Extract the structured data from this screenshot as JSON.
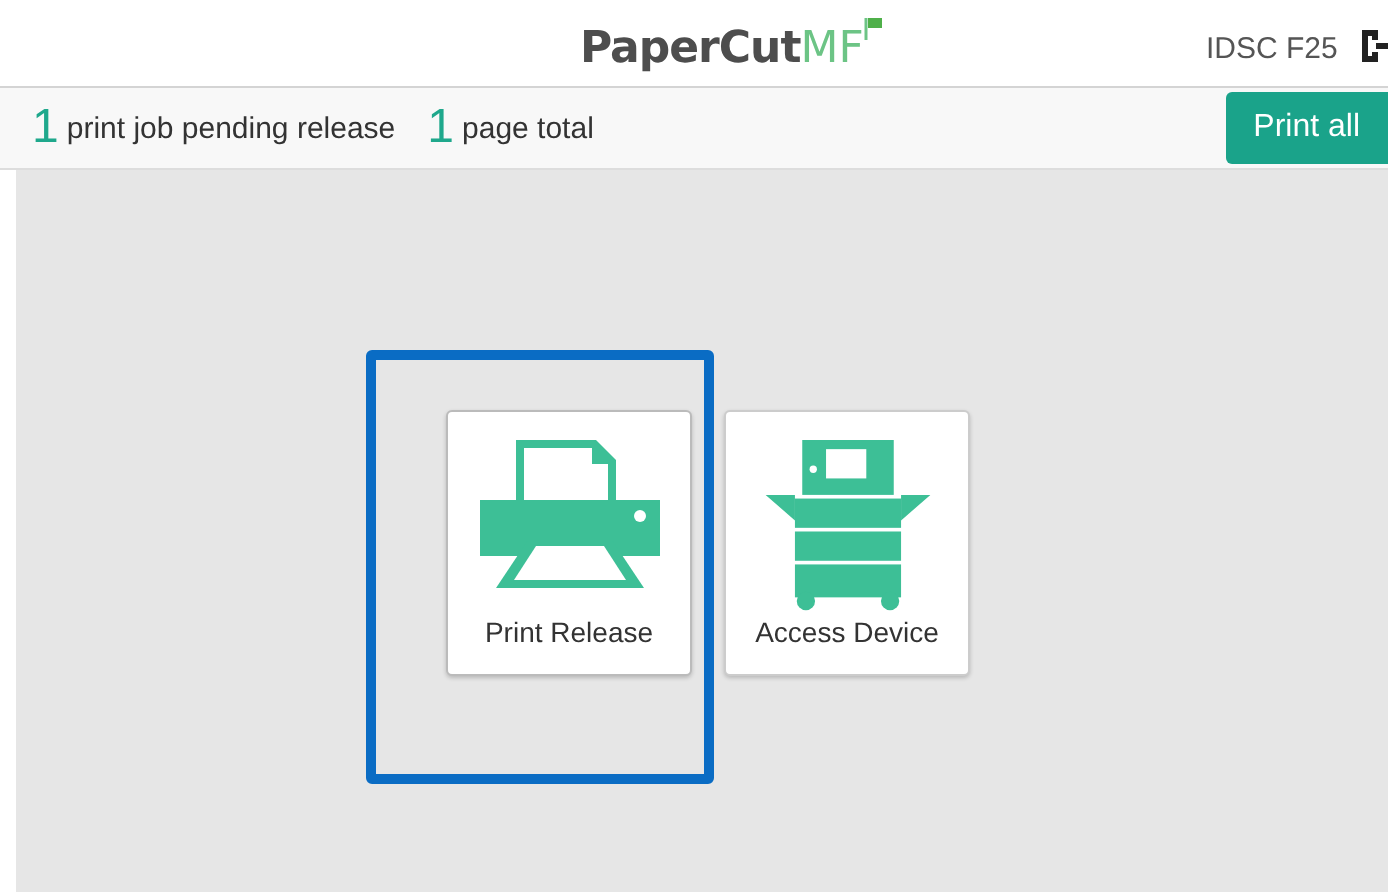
{
  "header": {
    "logo": {
      "name": "PaperCut",
      "suffix": "MF"
    },
    "device": "IDSC F25"
  },
  "summary": [
    {
      "count": "1",
      "label": "print job pending release"
    },
    {
      "count": "1",
      "label": "page total"
    }
  ],
  "print_all_button": "Print all",
  "tiles": [
    {
      "kind": "printer",
      "label": "Print Release",
      "selected": true
    },
    {
      "kind": "copier",
      "label": "Access Device",
      "selected": false
    }
  ]
}
